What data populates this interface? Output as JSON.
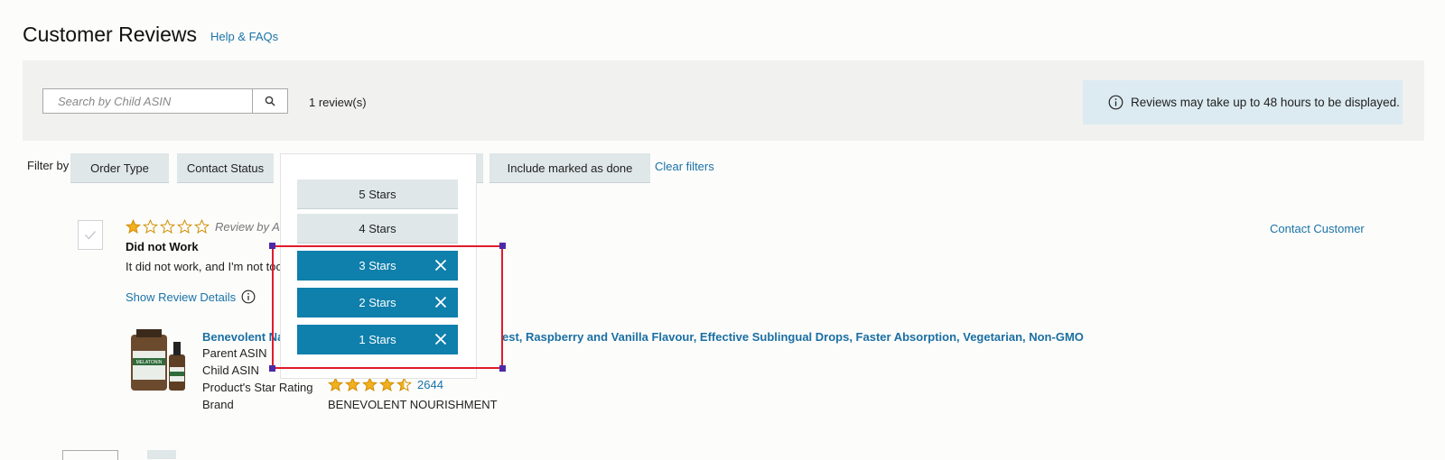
{
  "header": {
    "title": "Customer Reviews",
    "help_link": "Help & FAQs"
  },
  "search": {
    "placeholder": "Search by Child ASIN",
    "value": ""
  },
  "review_count": "1 review(s)",
  "notice": {
    "text": "Reviews may take up to 48 hours to be displayed."
  },
  "filters": {
    "label": "Filter by",
    "order_type": "Order Type",
    "contact_status": "Contact Status",
    "include_done": "Include marked as done",
    "clear": "Clear filters"
  },
  "star_dropdown": {
    "options": [
      {
        "label": "5 Stars",
        "selected": false
      },
      {
        "label": "4 Stars",
        "selected": false
      },
      {
        "label": "3 Stars",
        "selected": true
      },
      {
        "label": "2 Stars",
        "selected": true
      },
      {
        "label": "1 Stars",
        "selected": true
      }
    ]
  },
  "review": {
    "rating": 1,
    "max_rating": 5,
    "review_by": "Review by Am",
    "title": "Did not Work",
    "body": "It did not work, and I'm not too fo",
    "show_details": "Show Review Details",
    "contact": "Contact Customer"
  },
  "product": {
    "title_part1": "Benevolent Nat",
    "title_part2": "est, Raspberry and Vanilla Flavour, Effective Sublingual Drops, Faster Absorption, Vegetarian, Non-GMO",
    "parent_asin_label": "Parent ASIN",
    "child_asin_label": "Child ASIN",
    "rating_label": "Product's Star Rating",
    "rating_value": 4.5,
    "rating_count": "2644",
    "brand_label": "Brand",
    "brand": "BENEVOLENT NOURISHMENT",
    "image_label": "MELATONIN"
  },
  "colors": {
    "accent": "#0f7fab",
    "link": "#1a73a8",
    "star": "#f2b01e",
    "highlight": "#e01b2c"
  }
}
